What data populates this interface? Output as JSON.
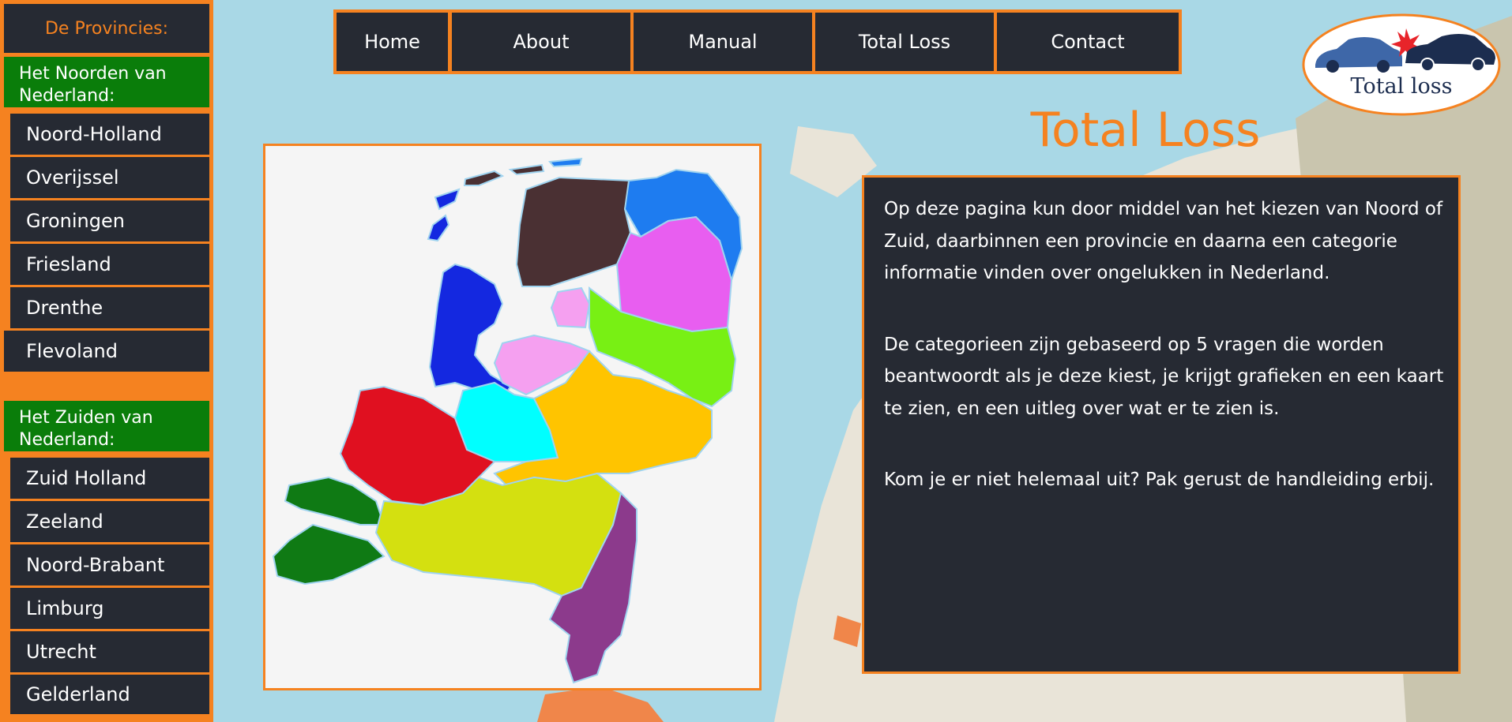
{
  "sidebar": {
    "heading": "De Provincies:",
    "north": {
      "title": "Het Noorden van Nederland:",
      "items": [
        "Noord-Holland",
        "Overijssel",
        "Groningen",
        "Friesland",
        "Drenthe",
        "Flevoland"
      ]
    },
    "south": {
      "title": "Het Zuiden van Nederland:",
      "items": [
        "Zuid Holland",
        "Zeeland",
        "Noord-Brabant",
        "Limburg",
        "Utrecht",
        "Gelderland"
      ]
    }
  },
  "nav": {
    "items": [
      "Home",
      "About",
      "Manual",
      "Total Loss",
      "Contact"
    ]
  },
  "logo": {
    "text": "Total loss",
    "icon": "car-crash-icon"
  },
  "page": {
    "title": "Total Loss",
    "paragraphs": [
      "Op deze pagina kun door middel van het kiezen van Noord of Zuid, daarbinnen een provincie en daarna een categorie informatie vinden over ongelukken in Nederland.",
      "De categorieen zijn gebaseerd op 5 vragen die worden beantwoordt als je deze kiest, je krijgt grafieken en een kaart te zien, en een uitleg over wat er te zien is.",
      "Kom je er niet helemaal uit? Pak gerust de handleiding erbij."
    ]
  },
  "colors": {
    "accent": "#f58220",
    "panel": "#262a33",
    "group": "#0a7d0a",
    "sea": "#a9d8e6"
  },
  "map": {
    "provinces": [
      {
        "name": "Friesland",
        "color": "#4a3033"
      },
      {
        "name": "Groningen",
        "color": "#1e7cf0"
      },
      {
        "name": "Drenthe",
        "color": "#e85ef0"
      },
      {
        "name": "Noord-Holland",
        "color": "#1428e0"
      },
      {
        "name": "Flevoland",
        "color": "#f5a0f0"
      },
      {
        "name": "Overijssel",
        "color": "#78f014"
      },
      {
        "name": "Gelderland",
        "color": "#ffc400"
      },
      {
        "name": "Utrecht",
        "color": "#00ffff"
      },
      {
        "name": "Zuid Holland",
        "color": "#e01020"
      },
      {
        "name": "Zeeland",
        "color": "#0f7a14"
      },
      {
        "name": "Noord-Brabant",
        "color": "#d4e010"
      },
      {
        "name": "Limburg",
        "color": "#8c3a8c"
      }
    ]
  }
}
